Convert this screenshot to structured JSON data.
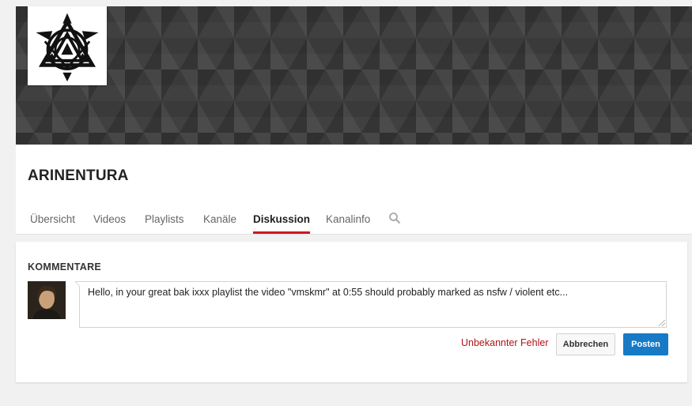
{
  "channel": {
    "name": "ARINENTURA"
  },
  "tabs": [
    {
      "label": "Übersicht",
      "active": false
    },
    {
      "label": "Videos",
      "active": false
    },
    {
      "label": "Playlists",
      "active": false
    },
    {
      "label": "Kanäle",
      "active": false
    },
    {
      "label": "Diskussion",
      "active": true
    },
    {
      "label": "Kanalinfo",
      "active": false
    }
  ],
  "discussion": {
    "section_title": "KOMMENTARE",
    "comment_value": "Hello, in your great bak ixxx playlist the video \"vmskmr\" at 0:55 should probably marked as nsfw / violent etc...",
    "error_message": "Unbekannter Fehler",
    "cancel_label": "Abbrechen",
    "post_label": "Posten"
  },
  "icons": {
    "search": "search-icon",
    "logo": "tribal-triangle-logo"
  },
  "colors": {
    "accent_red": "#cc181e",
    "error_red": "#b31217",
    "post_blue": "#167ac6"
  }
}
